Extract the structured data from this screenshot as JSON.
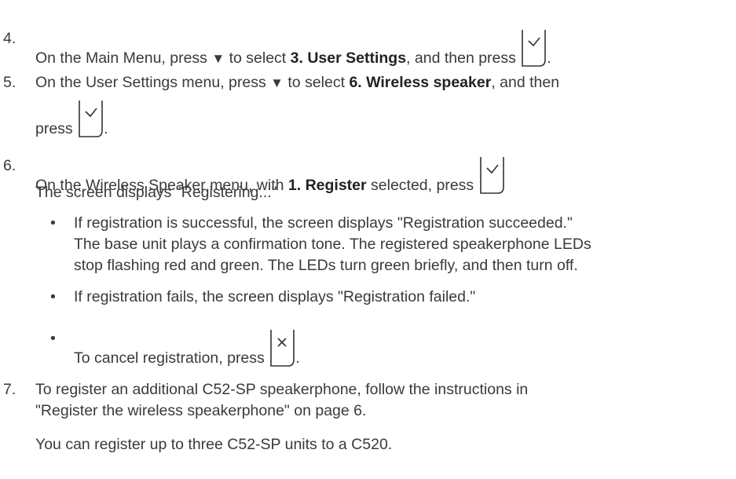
{
  "steps": [
    {
      "num": "4.",
      "pre": "On the Main Menu, press ",
      "arrow": "▼",
      "mid": " to select ",
      "bold": "3. User Settings",
      "post": ", and then press ",
      "end": ".",
      "icon": "checkmark-key-icon"
    },
    {
      "num": "5.",
      "pre": "On the User Settings menu, press ",
      "arrow": "▼",
      "mid": " to select ",
      "bold": "6. Wireless speaker",
      "post": ", and then",
      "line2": "press ",
      "end": ".",
      "icon": "checkmark-key-icon"
    },
    {
      "num": "6.",
      "pre": "On the Wireless Speaker menu, with ",
      "bold": "1. Register",
      "post": " selected, press ",
      "icon": "checkmark-key-icon",
      "note": "The screen displays \"Registering...\"",
      "bullets": [
        {
          "lines": [
            "If registration is successful, the screen displays \"Registration succeeded.\"",
            "The base unit plays a confirmation tone. The registered speakerphone LEDs",
            "stop flashing red and green. The LEDs turn green briefly, and then turn off."
          ]
        },
        {
          "lines": [
            "If registration fails, the screen displays \"Registration failed.\""
          ]
        },
        {
          "pre": "To cancel registration, press ",
          "end": ".",
          "icon": "cancel-key-icon"
        }
      ]
    },
    {
      "num": "7.",
      "line1": "To register an additional C52-SP speakerphone, follow the instructions in",
      "line2": "\"Register the wireless speakerphone\" on page 6.",
      "note": "You can register up to three C52-SP units to a C520."
    }
  ],
  "bullet_char": "•",
  "colors": {
    "text": "#3a3a3a",
    "icon_stroke": "#333333"
  }
}
